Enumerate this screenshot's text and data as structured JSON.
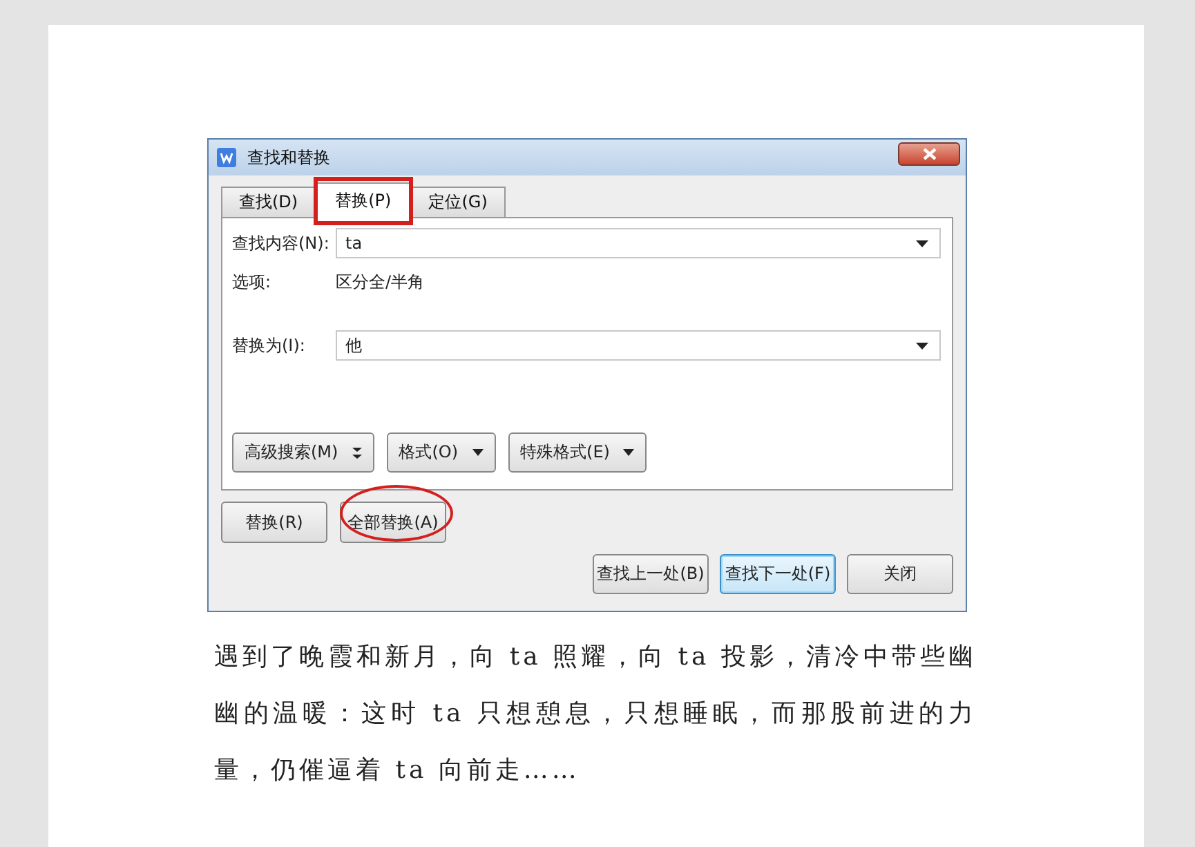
{
  "dialog": {
    "title": "查找和替换",
    "tabs": [
      {
        "label": "查找(D)",
        "selected": false,
        "highlighted": false
      },
      {
        "label": "替换(P)",
        "selected": true,
        "highlighted": true
      },
      {
        "label": "定位(G)",
        "selected": false,
        "highlighted": false
      }
    ],
    "find": {
      "label": "查找内容(N):",
      "value": "ta"
    },
    "options": {
      "label": "选项:",
      "value": "区分全/半角"
    },
    "replace": {
      "label": "替换为(I):",
      "value": "他"
    },
    "panel_buttons": [
      {
        "label": "高级搜索(M)",
        "kind": "expand"
      },
      {
        "label": "格式(O)",
        "kind": "menu"
      },
      {
        "label": "特殊格式(E)",
        "kind": "menu"
      }
    ],
    "replace_buttons": [
      {
        "label": "替换(R)",
        "circled": false
      },
      {
        "label": "全部替换(A)",
        "circled": true
      }
    ],
    "bottom_buttons": [
      {
        "label": "查找上一处(B)",
        "focused": false
      },
      {
        "label": "查找下一处(F)",
        "focused": true
      },
      {
        "label": "关闭",
        "focused": false
      }
    ]
  },
  "document": {
    "paragraph": "遇到了晚霞和新月，向 ta 照耀，向 ta 投影，清冷中带些幽幽的温暖：这时 ta 只想憩息，只想睡眠，而那股前进的力量，仍催逼着 ta 向前走……"
  }
}
